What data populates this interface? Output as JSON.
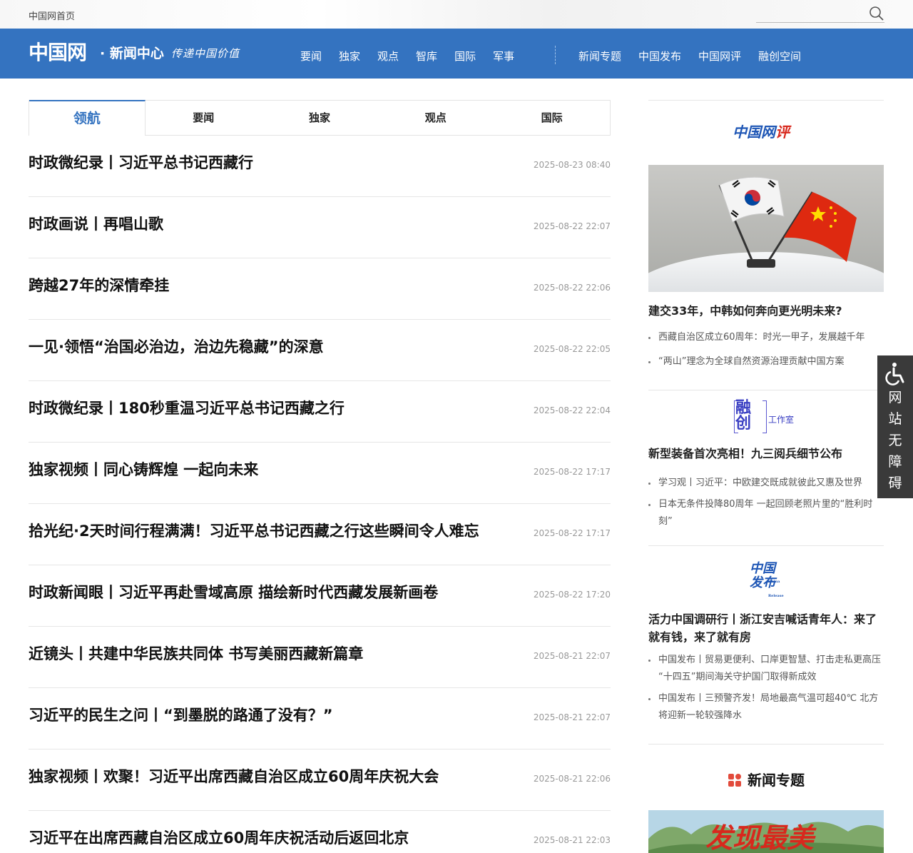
{
  "topbar": {
    "home_link": "中国网首页",
    "search_placeholder": ""
  },
  "nav": {
    "logo_mark": "中国网",
    "logo_name": "· 新闻中心",
    "logo_slogan": "传递中国价值",
    "menu_left": [
      "要闻",
      "独家",
      "观点",
      "智库",
      "国际",
      "军事"
    ],
    "menu_right": [
      "新闻专题",
      "中国发布",
      "中国网评",
      "融创空间"
    ]
  },
  "tabs": [
    "领航",
    "要闻",
    "独家",
    "观点",
    "国际"
  ],
  "news": [
    {
      "title": "时政微纪录丨习近平总书记西藏行",
      "date": "2025-08-23 08:40"
    },
    {
      "title": "时政画说丨再唱山歌",
      "date": "2025-08-22 22:07"
    },
    {
      "title": "跨越27年的深情牵挂",
      "date": "2025-08-22 22:06"
    },
    {
      "title": "一见·领悟“治国必治边，治边先稳藏”的深意",
      "date": "2025-08-22 22:05"
    },
    {
      "title": "时政微纪录丨180秒重温习近平总书记西藏之行",
      "date": "2025-08-22 22:04"
    },
    {
      "title": "独家视频丨同心铸辉煌 一起向未来",
      "date": "2025-08-22 17:17"
    },
    {
      "title": "拾光纪·2天时间行程满满！习近平总书记西藏之行这些瞬间令人难忘",
      "date": "2025-08-22 17:17"
    },
    {
      "title": "时政新闻眼丨习近平再赴雪域高原 描绘新时代西藏发展新画卷",
      "date": "2025-08-22 17:20"
    },
    {
      "title": "近镜头丨共建中华民族共同体 书写美丽西藏新篇章",
      "date": "2025-08-21 22:07"
    },
    {
      "title": "习近平的民生之问丨“到墨脱的路通了没有？”",
      "date": "2025-08-21 22:07"
    },
    {
      "title": "独家视频丨欢聚！习近平出席西藏自治区成立60周年庆祝大会",
      "date": "2025-08-21 22:06"
    },
    {
      "title": "习近平在出席西藏自治区成立60周年庆祝活动后返回北京",
      "date": "2025-08-21 22:03"
    }
  ],
  "sidebar": {
    "wangping": {
      "logo_main": "中国网",
      "logo_accent": "评",
      "headline": "建交33年，中韩如何奔向更光明未来?",
      "links": [
        "西藏自治区成立60周年：时光一甲子，发展越千年",
        "“两山”理念为全球自然资源治理贡献中国方案"
      ]
    },
    "rongchuang": {
      "logo_big": "融创",
      "logo_small": "工作室",
      "headline": "新型装备首次亮相！九三阅兵细节公布",
      "links": [
        "学习观丨习近平：中欧建交既成就彼此又惠及世界",
        "日本无条件投降80周年 一起回顾老照片里的“胜利时刻”"
      ]
    },
    "fabu": {
      "logo_text": "中国发布",
      "logo_en": "China Release",
      "headline": "活力中国调研行丨浙江安吉喊话青年人：来了就有钱，来了就有房",
      "links": [
        "中国发布丨贸易更便利、口岸更智慧、打击走私更高压 “十四五”期间海关守护国门取得新成效",
        "中国发布丨三预警齐发！局地最高气温可超40℃ 北方将迎新一轮较强降水"
      ]
    },
    "topics": {
      "heading": "新闻专题",
      "banner_text": "发现最美"
    }
  },
  "accessibility": {
    "label": "网站无障碍"
  },
  "colors": {
    "brand_blue": "#3473c0",
    "accent_red": "#d8281d"
  }
}
